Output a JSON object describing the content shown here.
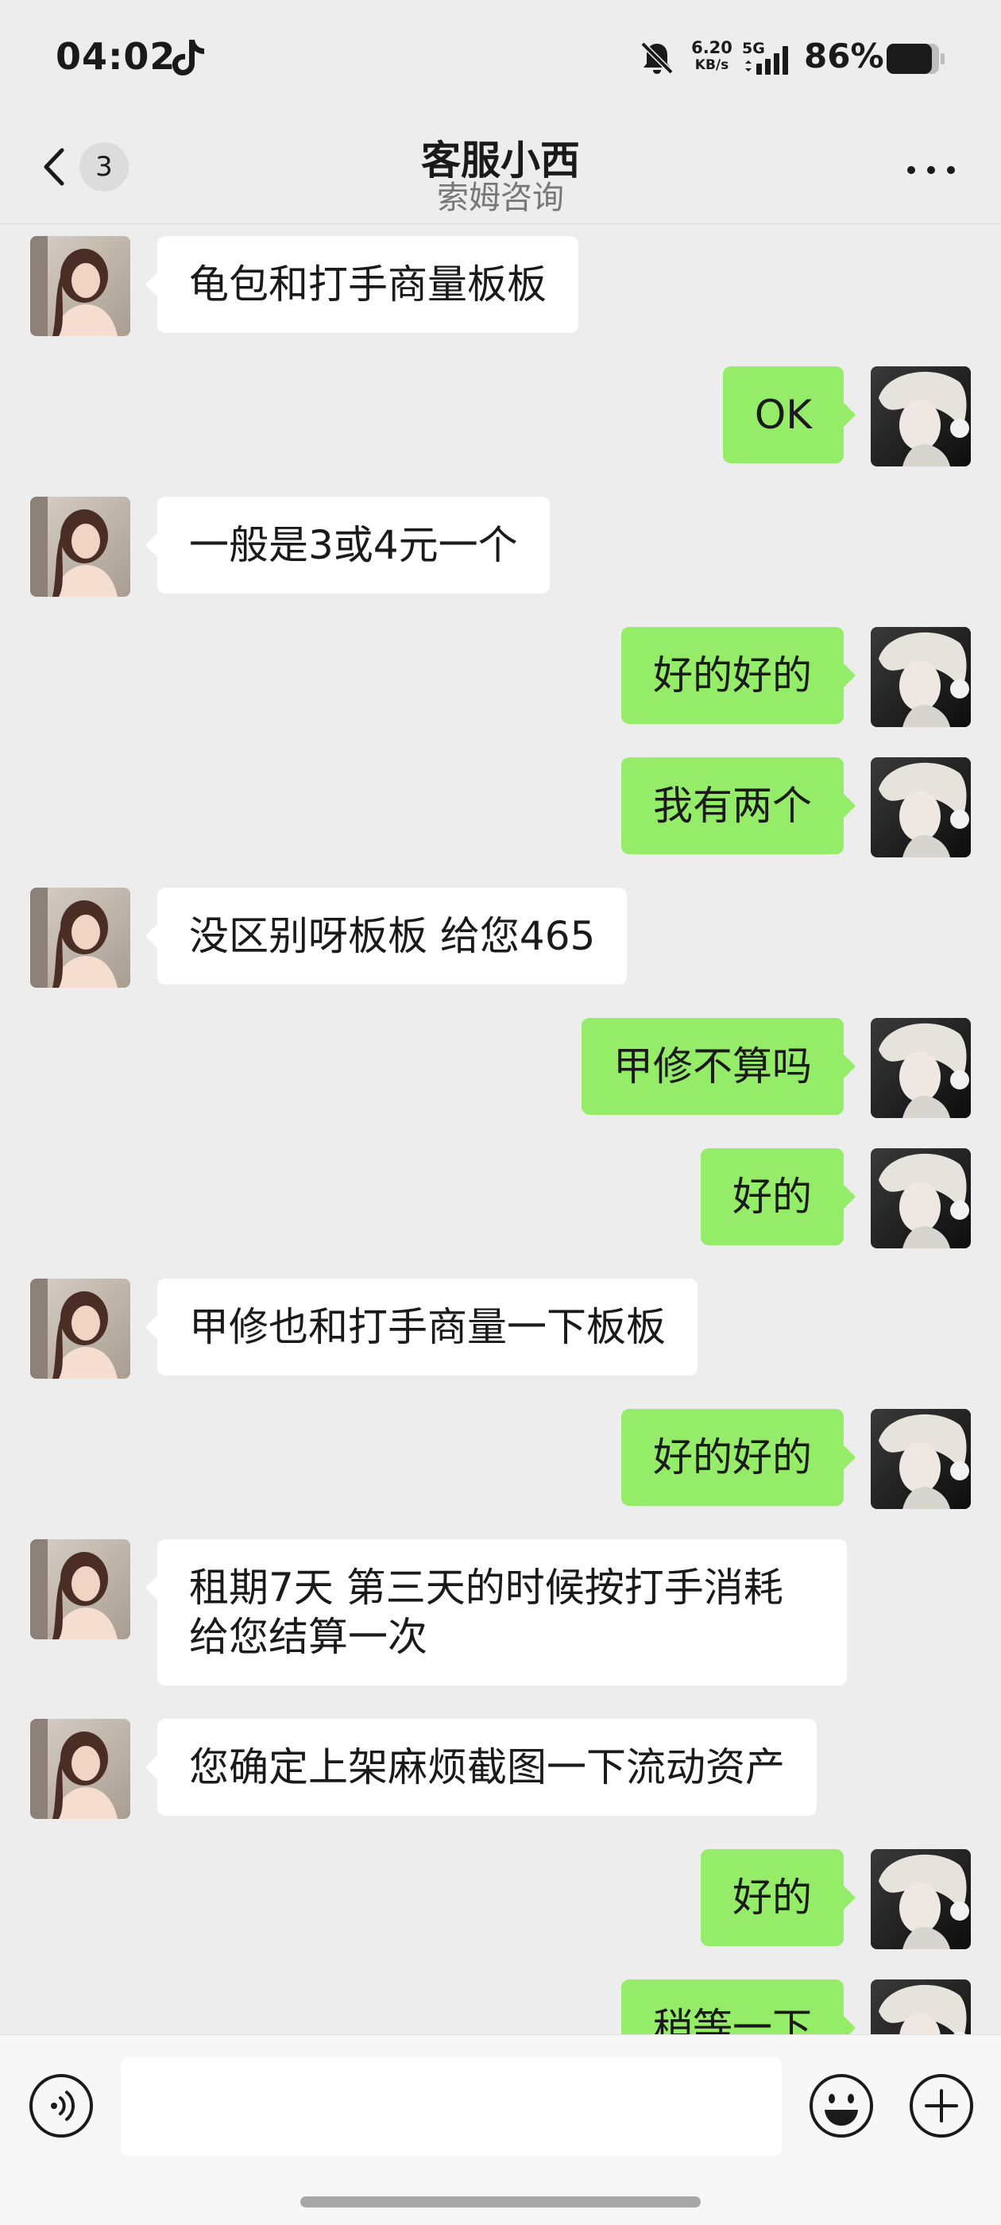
{
  "status_bar": {
    "time": "04:02",
    "net_speed_value": "6.20",
    "net_speed_unit": "KB/s",
    "network_type": "5G",
    "battery": "86%",
    "icons": [
      "tiktok-icon",
      "mute-icon",
      "signal-icon",
      "battery-icon"
    ]
  },
  "header": {
    "back_icon": "chevron-left-icon",
    "unread_count": "3",
    "title": "客服小西",
    "subtitle": "索姆咨询",
    "more_icon": "more-dots-icon"
  },
  "messages": [
    {
      "side": "left",
      "text": "龟包和打手商量板板"
    },
    {
      "side": "right",
      "text": "OK"
    },
    {
      "side": "left",
      "text": "一般是3或4元一个"
    },
    {
      "side": "right",
      "text": "好的好的"
    },
    {
      "side": "right",
      "text": "我有两个"
    },
    {
      "side": "left",
      "text": "没区别呀板板 给您465"
    },
    {
      "side": "right",
      "text": "甲修不算吗"
    },
    {
      "side": "right",
      "text": "好的"
    },
    {
      "side": "left",
      "text": "甲修也和打手商量一下板板"
    },
    {
      "side": "right",
      "text": "好的好的"
    },
    {
      "side": "left",
      "text": "租期7天 第三天的时候按打手消耗给您结算一次"
    },
    {
      "side": "left",
      "text": "您确定上架麻烦截图一下流动资产"
    },
    {
      "side": "right",
      "text": "好的"
    },
    {
      "side": "right",
      "text": "稍等一下"
    }
  ],
  "input_bar": {
    "voice_icon": "voice-icon",
    "emoji_icon": "emoji-icon",
    "plus_icon": "plus-icon",
    "placeholder": ""
  },
  "colors": {
    "background": "#ededed",
    "sent_bubble": "#95ec69",
    "received_bubble": "#ffffff",
    "input_bar": "#f7f7f7"
  }
}
